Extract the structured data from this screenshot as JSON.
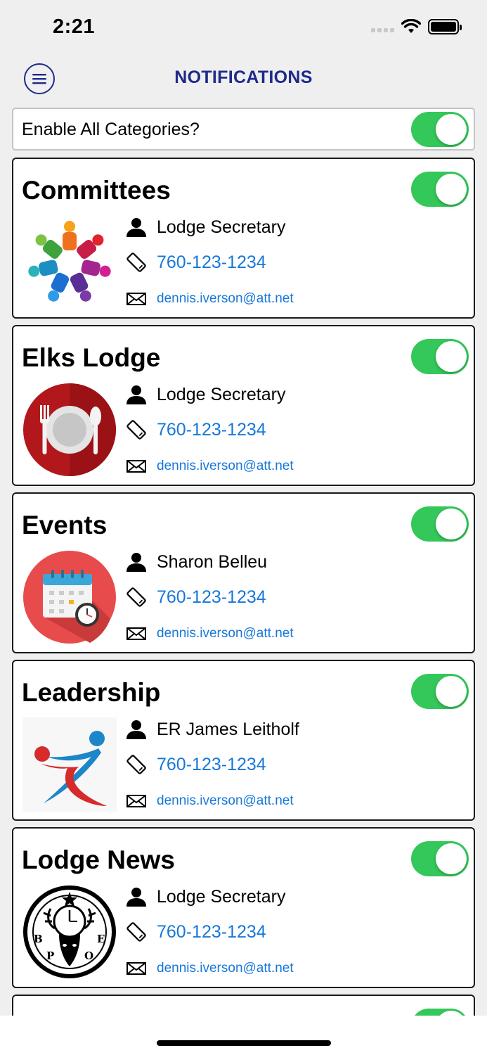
{
  "status_bar": {
    "time": "2:21"
  },
  "nav": {
    "title": "NOTIFICATIONS",
    "menu_icon": "hamburger-circle-icon",
    "accent_color": "#1e2a8a"
  },
  "enable_all": {
    "label": "Enable All Categories?",
    "enabled": true
  },
  "toggle_on_color": "#34c759",
  "link_color": "#1677d9",
  "categories": [
    {
      "title": "Committees",
      "enabled": true,
      "image": "committee-people-circle-icon",
      "contact": "Lodge Secretary",
      "phone": "760-123-1234",
      "email": "dennis.iverson@att.net"
    },
    {
      "title": "Elks Lodge",
      "enabled": true,
      "image": "plate-fork-spoon-icon",
      "contact": "Lodge Secretary",
      "phone": "760-123-1234",
      "email": "dennis.iverson@att.net"
    },
    {
      "title": "Events",
      "enabled": true,
      "image": "calendar-clock-icon",
      "contact": "Sharon Belleu",
      "phone": "760-123-1234",
      "email": "dennis.iverson@att.net"
    },
    {
      "title": "Leadership",
      "enabled": true,
      "image": "leadership-figures-icon",
      "contact": "ER James Leitholf",
      "phone": "760-123-1234",
      "email": "dennis.iverson@att.net"
    },
    {
      "title": "Lodge News",
      "enabled": true,
      "image": "bpoe-elk-emblem-icon",
      "contact": "Lodge Secretary",
      "phone": "760-123-1234",
      "email": "dennis.iverson@att.net"
    }
  ],
  "partial_category": {
    "enabled": true
  }
}
